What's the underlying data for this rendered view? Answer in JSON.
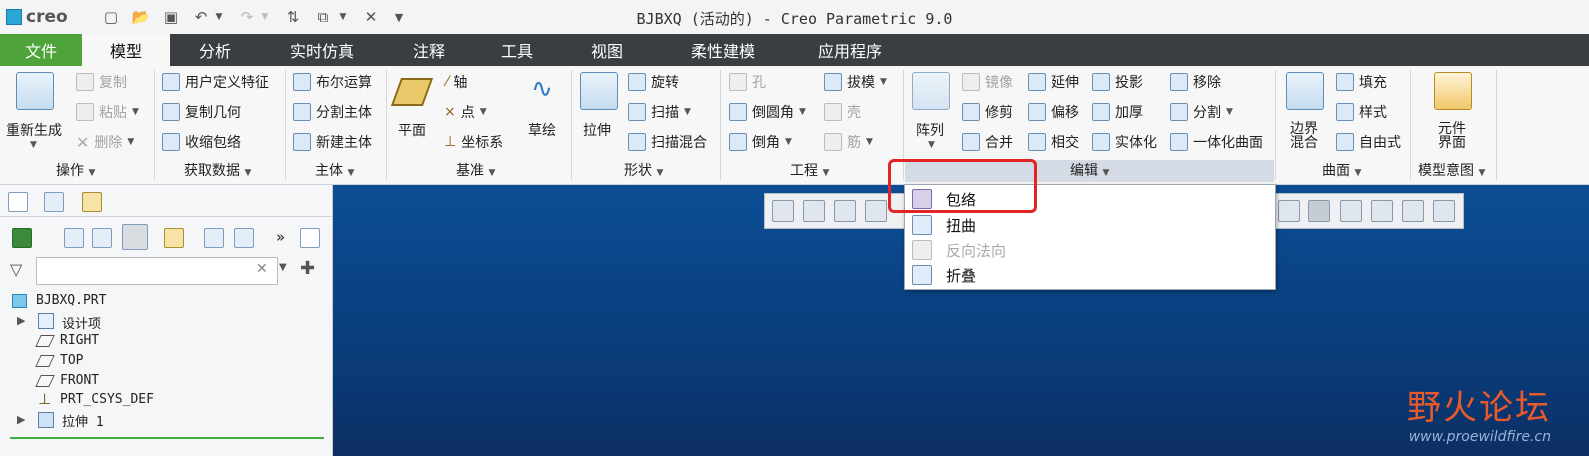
{
  "app": {
    "logo": "creo",
    "window_title": "BJBXQ (活动的) - Creo Parametric 9.0"
  },
  "tabs": [
    {
      "label": "文件"
    },
    {
      "label": "模型"
    },
    {
      "label": "分析"
    },
    {
      "label": "实时仿真"
    },
    {
      "label": "注释"
    },
    {
      "label": "工具"
    },
    {
      "label": "视图"
    },
    {
      "label": "柔性建模"
    },
    {
      "label": "应用程序"
    }
  ],
  "ribbon": {
    "operations": {
      "regenerate": "重新生成",
      "copy": "复制",
      "paste": "粘贴",
      "delete": "删除",
      "group": "操作"
    },
    "getdata": {
      "udf": "用户定义特征",
      "copy_geom": "复制几何",
      "shrinkwrap": "收缩包络",
      "group": "获取数据"
    },
    "body": {
      "boolean": "布尔运算",
      "split_body": "分割主体",
      "new_body": "新建主体",
      "group": "主体"
    },
    "datum": {
      "plane": "平面",
      "axis": "轴",
      "point": "点",
      "csys": "坐标系",
      "sketch": "草绘",
      "group": "基准"
    },
    "shapes": {
      "extrude": "拉伸",
      "revolve": "旋转",
      "sweep": "扫描",
      "swept_blend": "扫描混合",
      "group": "形状"
    },
    "engineering": {
      "hole": "孔",
      "round": "倒圆角",
      "chamfer": "倒角",
      "draft": "拔模",
      "shell": "壳",
      "rib": "筋",
      "group": "工程"
    },
    "editing": {
      "pattern": "阵列",
      "mirror": "镜像",
      "trim": "修剪",
      "merge": "合并",
      "extend": "延伸",
      "offset": "偏移",
      "intersect": "相交",
      "project": "投影",
      "thicken": "加厚",
      "solidify": "实体化",
      "remove": "移除",
      "split": "分割",
      "unify": "一体化曲面",
      "group": "编辑"
    },
    "surfaces": {
      "boundary_blend": "边界\n混合",
      "fill": "填充",
      "style": "样式",
      "freestyle": "自由式",
      "group": "曲面"
    },
    "intent": {
      "component_interface": "元件\n界面",
      "group": "模型意图"
    }
  },
  "edit_menu": {
    "items": [
      {
        "label": "包络",
        "enabled": true,
        "icon": "wrap-icon"
      },
      {
        "label": "扭曲",
        "enabled": true,
        "icon": "warp-icon"
      },
      {
        "label": "反向法向",
        "enabled": false,
        "icon": "flip-normal-icon"
      },
      {
        "label": "折叠",
        "enabled": true,
        "icon": "fold-icon"
      }
    ]
  },
  "model_tree": {
    "filter_placeholder": "",
    "items": [
      {
        "label": "BJBXQ.PRT",
        "expandable": false
      },
      {
        "label": "设计项",
        "expandable": true
      },
      {
        "label": "RIGHT",
        "expandable": false
      },
      {
        "label": "TOP",
        "expandable": false
      },
      {
        "label": "FRONT",
        "expandable": false
      },
      {
        "label": "PRT_CSYS_DEF",
        "expandable": false
      },
      {
        "label": "拉伸 1",
        "expandable": true
      }
    ]
  },
  "watermark": {
    "main": "野火论坛",
    "url": "www.proewildfire.cn"
  },
  "colors": {
    "file_tab": "#4ea33a",
    "tab_bar": "#3a3d42",
    "graphics_bg": "#0b4d94",
    "highlight": "#e12424"
  }
}
